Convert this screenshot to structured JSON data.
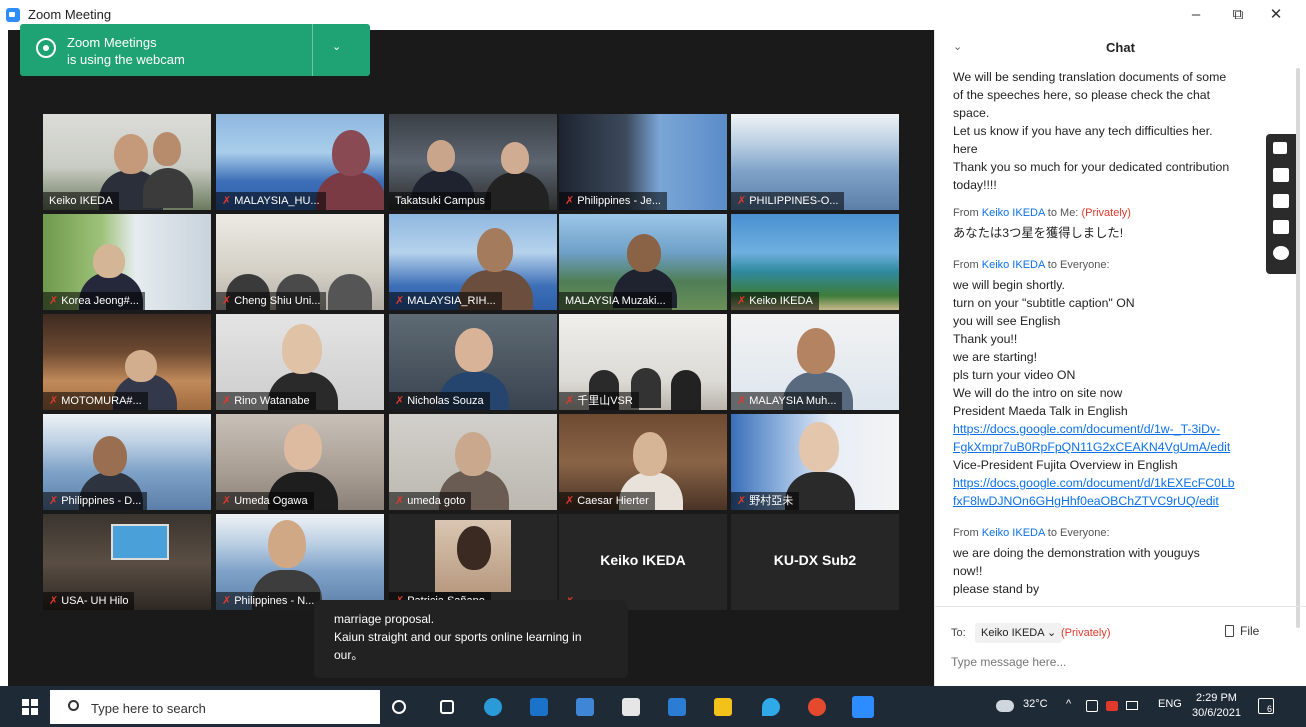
{
  "window": {
    "title": "Zoom Meeting",
    "minimize": "–",
    "restore": "⧉",
    "close": "✕"
  },
  "toast": {
    "line1": "Zoom Meetings",
    "line2": "is using the webcam",
    "chevron": "⌄"
  },
  "participants": [
    "Keiko IKEDA",
    "MALAYSIA_HU...",
    "Takatsuki Campus",
    "Philippines - Je...",
    "PHILIPPINES-O...",
    "Korea Jeong#...",
    "Cheng Shiu Uni...",
    "MALAYSIA_RIH...",
    "MALAYSIA Muzaki...",
    "Keiko IKEDA",
    "MOTOMURA#...",
    "Rino Watanabe",
    "Nicholas Souza",
    "千里山VSR",
    "MALAYSIA Muh...",
    "Philippines - D...",
    "Umeda  Ogawa",
    "umeda goto",
    "Caesar Hierter",
    "野村亞未",
    "USA- UH Hilo",
    "Philippines - N...",
    "Patricia Sañano",
    "Keiko IKEDA",
    "KU-DX Sub2"
  ],
  "caption": {
    "line1": "marriage proposal.",
    "line2": "Kaiun straight and our sports online learning in",
    "line3": "our。"
  },
  "chat": {
    "title": "Chat",
    "collapse": "⌄",
    "intro": [
      "We will be sending translation documents of some",
      "of the speeches here, so please check the chat",
      "space.",
      "Let us know if you have any tech difficulties her.",
      "here",
      "Thank you so much for your dedicated contribution",
      "today!!!!"
    ],
    "m1": {
      "from_prefix": "From",
      "sender": "Keiko IKEDA",
      "to_word": "to",
      "recipient": "Me:",
      "privately": "(Privately)",
      "text": "あなたは3つ星を獲得しました!"
    },
    "m2": {
      "from_prefix": "From",
      "sender": "Keiko IKEDA",
      "to_word": "to",
      "recipient": "Everyone:",
      "lines": [
        "we will begin shortly.",
        "turn on your \"subtitle caption\" ON",
        "you will see English",
        "Thank you!!",
        "we are starting!",
        "pls turn your video ON",
        "We will do the intro on site now",
        "President Maeda Talk in English"
      ],
      "link1a": "https://docs.google.com/document/d/1w-_T-3iDv-",
      "link1b": "FgkXmpr7uB0RpFpQN11G2xCEAKN4VgUmA/edit",
      "vp": "Vice-President Fujita Overview in English",
      "link2a": "https://docs.google.com/document/d/1kEXEcFC0Lb",
      "link2b": "fxF8lwDJNOn6GHgHhf0eaOBChZTVC9rUQ/edit"
    },
    "m3": {
      "from_prefix": "From",
      "sender": "Keiko IKEDA",
      "to_word": "to",
      "recipient": "Everyone:",
      "lines": [
        "we are doing the demonstration with youguys",
        "now!!",
        "please stand by"
      ]
    },
    "footer": {
      "to_label": "To:",
      "to_value": "Keiko IKEDA ⌄",
      "privately": "(Privately)",
      "file": "File",
      "placeholder": "Type message here..."
    }
  },
  "taskbar": {
    "search_placeholder": "Type here to search",
    "weather": "32°C",
    "language": "ENG",
    "time": "2:29 PM",
    "date": "30/6/2021",
    "notifications": "6"
  },
  "colors": {
    "zoom_blue": "#2d8cff",
    "toast_green": "#20a374",
    "mute_red": "#e0392b",
    "link_blue": "#0e71eb",
    "active_speaker": "#c8d13a"
  }
}
